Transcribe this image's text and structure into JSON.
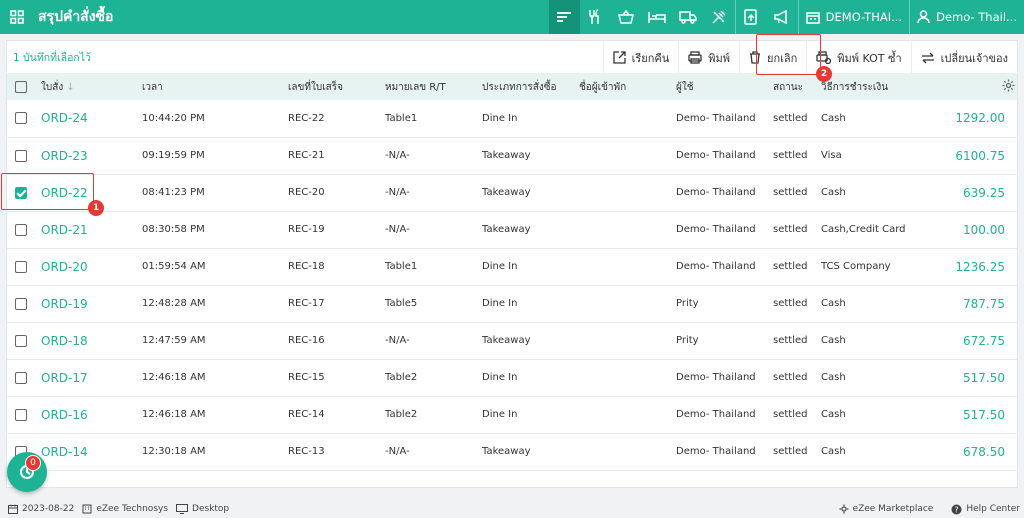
{
  "header": {
    "title": "สรุปคำสั่งซื้อ",
    "property_label": "DEMO-THAI...",
    "user_label": "Demo- Thail..."
  },
  "toolbar": {
    "selected_count": "1 บันทึกที่เลือกไว้",
    "recall_label": "เรียกคืน",
    "print_label": "พิมพ์",
    "cancel_label": "ยกเลิก",
    "reprint_kot_label": "พิมพ์ KOT ซ้ำ",
    "change_owner_label": "เปลี่ยนเจ้าของ"
  },
  "table": {
    "columns": [
      "ใบสั่ง",
      "เวลา",
      "เลขที่ใบเสร็จ",
      "หมายเลข R/T",
      "ประเภทการสั่งซื้อ",
      "ชื่อผู้เข้าพัก",
      "ผู้ใช้",
      "สถานะ",
      "วิธีการชำระเงิน"
    ],
    "rows": [
      {
        "order": "ORD-24",
        "time": "10:44:20 PM",
        "receipt": "REC-22",
        "rt": "Table1",
        "type": "Dine In",
        "guest": "",
        "user": "Demo- Thailand",
        "status": "settled",
        "payment": "Cash",
        "amount": "1292.00",
        "checked": false
      },
      {
        "order": "ORD-23",
        "time": "09:19:59 PM",
        "receipt": "REC-21",
        "rt": "-N/A-",
        "type": "Takeaway",
        "guest": "",
        "user": "Demo- Thailand",
        "status": "settled",
        "payment": "Visa",
        "amount": "6100.75",
        "checked": false
      },
      {
        "order": "ORD-22",
        "time": "08:41:23 PM",
        "receipt": "REC-20",
        "rt": "-N/A-",
        "type": "Takeaway",
        "guest": "",
        "user": "Demo- Thailand",
        "status": "settled",
        "payment": "Cash",
        "amount": "639.25",
        "checked": true
      },
      {
        "order": "ORD-21",
        "time": "08:30:58 PM",
        "receipt": "REC-19",
        "rt": "-N/A-",
        "type": "Takeaway",
        "guest": "",
        "user": "Demo- Thailand",
        "status": "settled",
        "payment": "Cash,Credit Card",
        "amount": "100.00",
        "checked": false
      },
      {
        "order": "ORD-20",
        "time": "01:59:54 AM",
        "receipt": "REC-18",
        "rt": "Table1",
        "type": "Dine In",
        "guest": "",
        "user": "Demo- Thailand",
        "status": "settled",
        "payment": "TCS Company",
        "amount": "1236.25",
        "checked": false
      },
      {
        "order": "ORD-19",
        "time": "12:48:28 AM",
        "receipt": "REC-17",
        "rt": "Table5",
        "type": "Dine In",
        "guest": "",
        "user": "Prity",
        "status": "settled",
        "payment": "Cash",
        "amount": "787.75",
        "checked": false
      },
      {
        "order": "ORD-18",
        "time": "12:47:59 AM",
        "receipt": "REC-16",
        "rt": "-N/A-",
        "type": "Takeaway",
        "guest": "",
        "user": "Prity",
        "status": "settled",
        "payment": "Cash",
        "amount": "672.75",
        "checked": false
      },
      {
        "order": "ORD-17",
        "time": "12:46:18 AM",
        "receipt": "REC-15",
        "rt": "Table2",
        "type": "Dine In",
        "guest": "",
        "user": "Demo- Thailand",
        "status": "settled",
        "payment": "Cash",
        "amount": "517.50",
        "checked": false
      },
      {
        "order": "ORD-16",
        "time": "12:46:18 AM",
        "receipt": "REC-14",
        "rt": "Table2",
        "type": "Dine In",
        "guest": "",
        "user": "Demo- Thailand",
        "status": "settled",
        "payment": "Cash",
        "amount": "517.50",
        "checked": false
      },
      {
        "order": "ORD-14",
        "time": "12:30:18 AM",
        "receipt": "REC-13",
        "rt": "-N/A-",
        "type": "Takeaway",
        "guest": "",
        "user": "Demo- Thailand",
        "status": "settled",
        "payment": "Cash",
        "amount": "678.50",
        "checked": false
      }
    ]
  },
  "annotations": {
    "step1": "1",
    "step2": "2"
  },
  "fab": {
    "badge": "0"
  },
  "footer": {
    "date": "2023-08-22",
    "company": "eZee Technosys",
    "device": "Desktop",
    "marketplace": "eZee Marketplace",
    "help": "Help Center"
  },
  "colors": {
    "accent": "#1db394",
    "highlight": "#e53935"
  }
}
